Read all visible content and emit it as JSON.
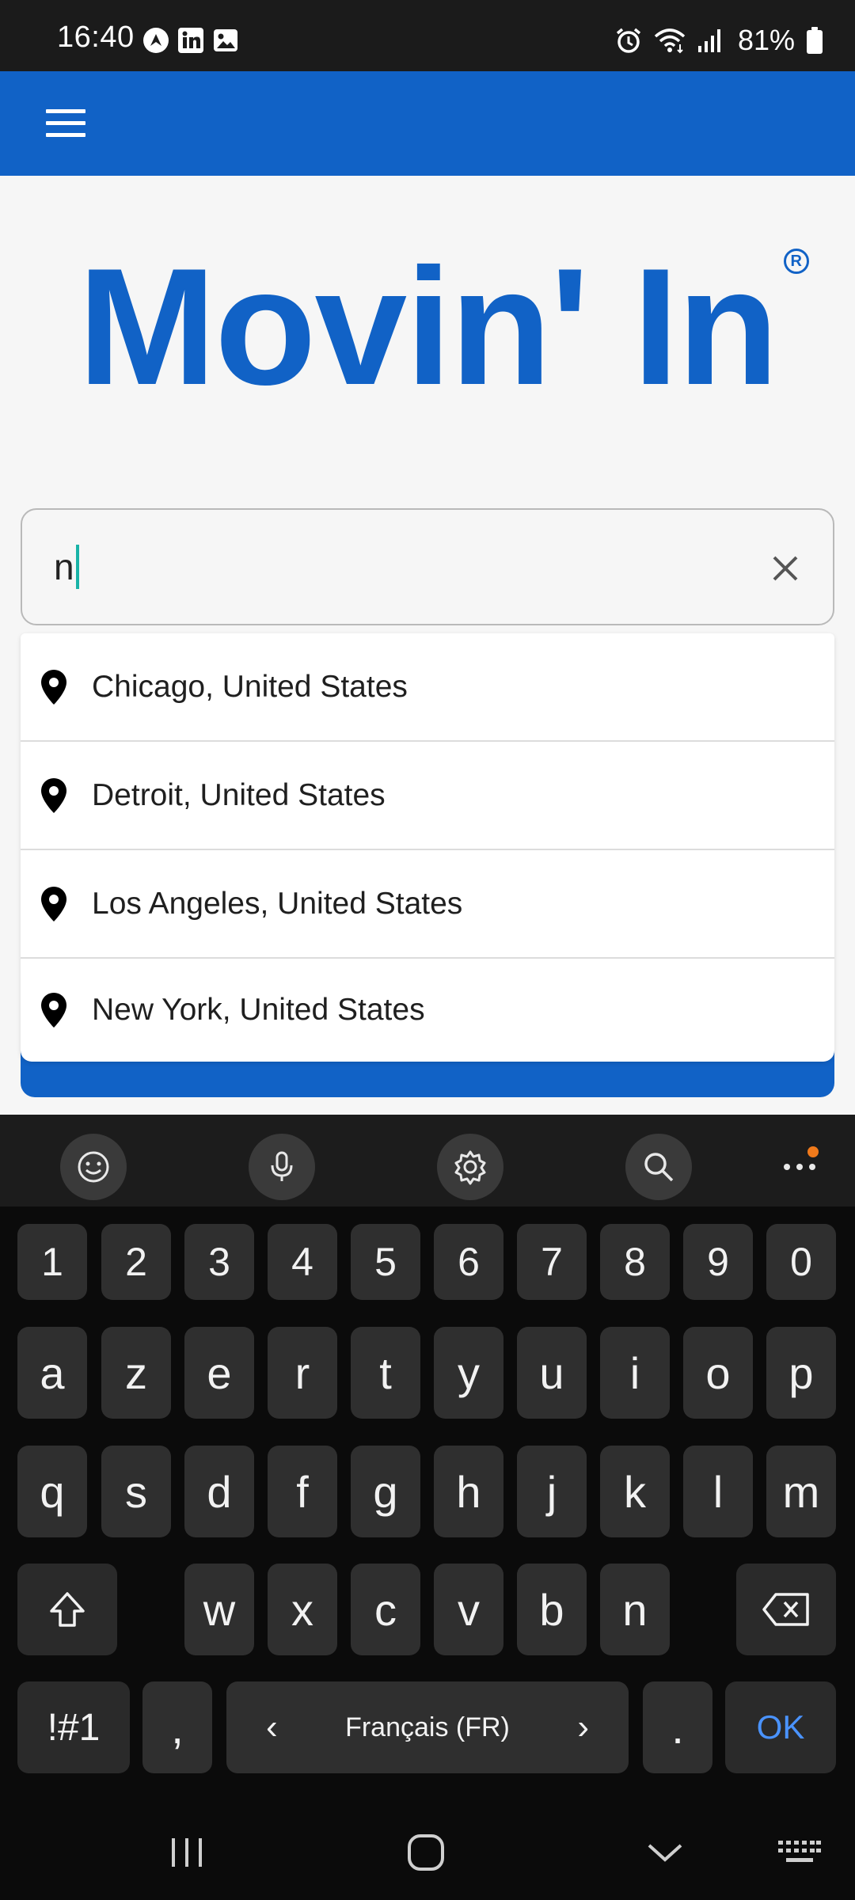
{
  "status_bar": {
    "time": "16:40",
    "notification_icons": [
      "navigation-app-icon",
      "linkedin-icon",
      "gallery-icon"
    ],
    "system_icons": [
      "alarm-icon",
      "wifi-icon",
      "signal-icon",
      "battery-icon"
    ],
    "battery_percent": "81%"
  },
  "app_bar": {
    "menu_icon": "hamburger-menu-icon",
    "color": "#1162c6"
  },
  "logo": {
    "text": "Movin' In",
    "registered_mark": "R"
  },
  "search": {
    "value": "n",
    "clear_icon": "close-icon"
  },
  "suggestions": [
    {
      "label": "Chicago, United States",
      "icon": "location-pin-icon"
    },
    {
      "label": "Detroit, United States",
      "icon": "location-pin-icon"
    },
    {
      "label": "Los Angeles, United States",
      "icon": "location-pin-icon"
    },
    {
      "label": "New York, United States",
      "icon": "location-pin-icon"
    }
  ],
  "keyboard": {
    "toolbar": [
      "emoji-icon",
      "microphone-icon",
      "settings-icon",
      "search-icon",
      "more-icon"
    ],
    "row_numbers": [
      "1",
      "2",
      "3",
      "4",
      "5",
      "6",
      "7",
      "8",
      "9",
      "0"
    ],
    "row1": [
      "a",
      "z",
      "e",
      "r",
      "t",
      "y",
      "u",
      "i",
      "o",
      "p"
    ],
    "row2": [
      "q",
      "s",
      "d",
      "f",
      "g",
      "h",
      "j",
      "k",
      "l",
      "m"
    ],
    "row3": [
      "w",
      "x",
      "c",
      "v",
      "b",
      "n"
    ],
    "symbols_key": "!#1",
    "comma_key": ",",
    "space_label": "Français (FR)",
    "space_left": "‹",
    "space_right": "›",
    "period_key": ".",
    "ok_key": "OK"
  },
  "nav_bar": {
    "buttons": [
      "recent-apps-icon",
      "home-icon",
      "back-icon",
      "keyboard-switch-icon"
    ]
  },
  "colors": {
    "brand": "#1162c6",
    "caret": "#19b3a7",
    "ok_key": "#4a93ff",
    "notification_dot": "#f07a1b"
  }
}
